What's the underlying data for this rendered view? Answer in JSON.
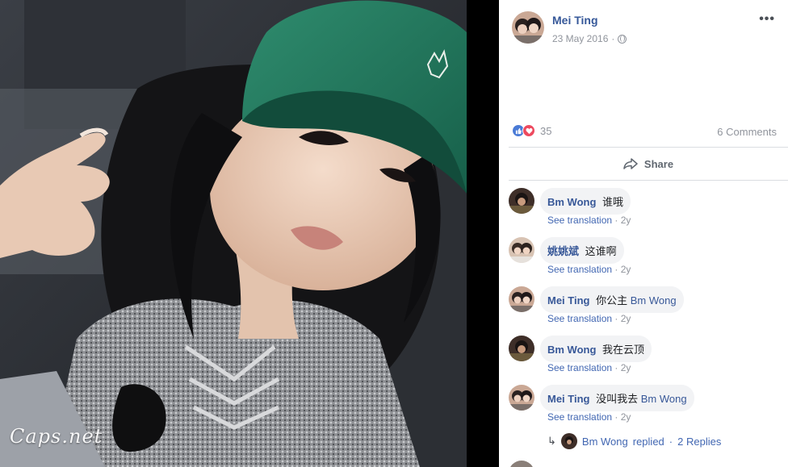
{
  "photo": {
    "watermark": "Caps.net"
  },
  "post": {
    "author": "Mei Ting",
    "date": "23 May 2016",
    "date_separator": "·",
    "privacy_icon": "globe-icon",
    "more_icon": "more-options-icon",
    "more_glyph": "•••",
    "reaction_count": "35",
    "comment_count": "6 Comments",
    "share_label": "Share"
  },
  "comments": [
    {
      "author": "Bm Wong",
      "text": "谁哦",
      "mention": "",
      "translate": "See translation",
      "age": "2y"
    },
    {
      "author": "姚姚斌",
      "text": "这谁啊",
      "mention": "",
      "translate": "See translation",
      "age": "2y"
    },
    {
      "author": "Mei Ting",
      "text": "你公主",
      "mention": "Bm Wong",
      "translate": "See translation",
      "age": "2y"
    },
    {
      "author": "Bm Wong",
      "text": "我在云顶",
      "mention": "",
      "translate": "See translation",
      "age": "2y"
    },
    {
      "author": "Mei Ting",
      "text": "没叫我去",
      "mention": "Bm Wong",
      "translate": "See translation",
      "age": "2y"
    }
  ],
  "replies": {
    "author": "Bm Wong",
    "action": "replied",
    "separator": "·",
    "count_label": "2 Replies"
  },
  "meta_separator": " · ",
  "colors": {
    "link": "#365899",
    "muted": "#90949c",
    "bubble": "#f2f3f5",
    "like": "#4a7bd6",
    "love": "#ed4a5f"
  }
}
